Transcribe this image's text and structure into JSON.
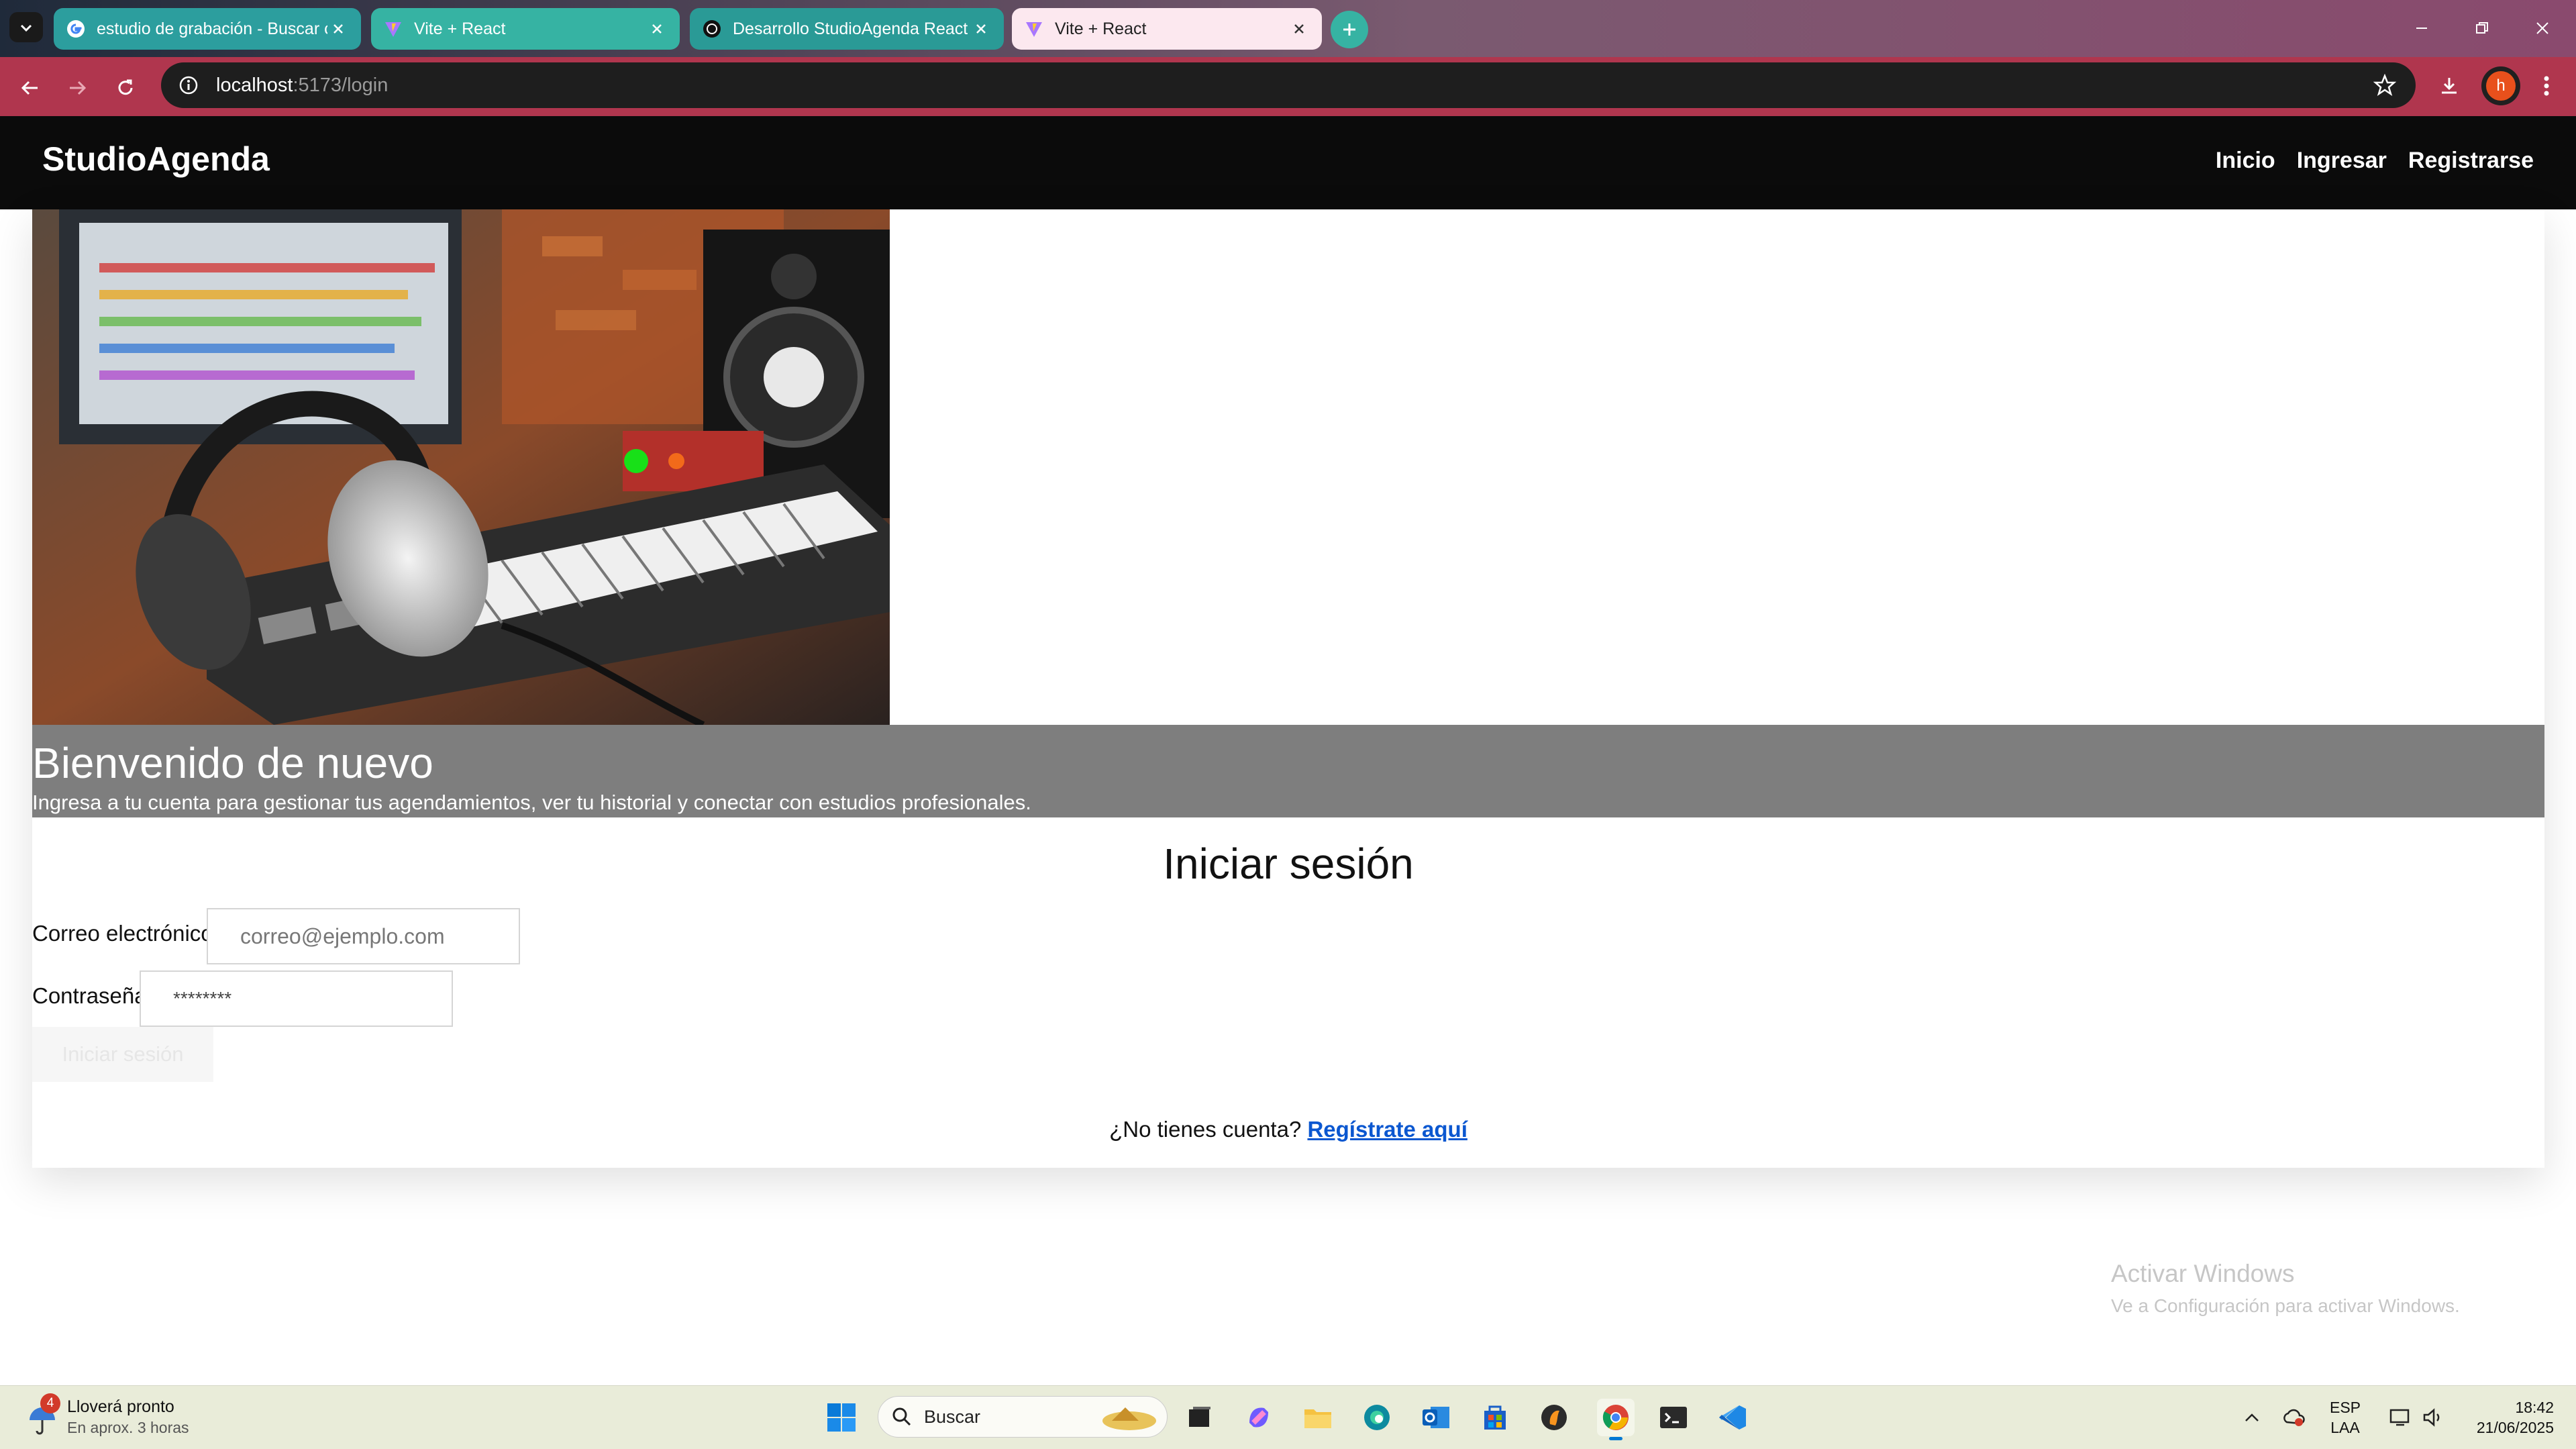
{
  "browser": {
    "tabs": [
      {
        "title": "estudio de grabación - Buscar c",
        "favicon": "google-icon"
      },
      {
        "title": "Vite + React",
        "favicon": "vite-icon"
      },
      {
        "title": "Desarrollo StudioAgenda React",
        "favicon": "chatgpt-icon"
      },
      {
        "title": "Vite + React",
        "favicon": "vite-icon",
        "active": true
      }
    ],
    "url_host": "localhost",
    "url_path": ":5173/login",
    "profile_initial": "h"
  },
  "app": {
    "brand": "StudioAgenda",
    "nav": [
      "Inicio",
      "Ingresar",
      "Registrarse"
    ]
  },
  "hero": {
    "title": "Bienvenido de nuevo",
    "subtitle": "Ingresa a tu cuenta para gestionar tus agendamientos, ver tu historial y conectar con estudios profesionales."
  },
  "login": {
    "heading": "Iniciar sesión",
    "email_label": "Correo electrónico",
    "email_placeholder": "correo@ejemplo.com",
    "password_label": "Contraseña",
    "password_value": "********",
    "submit_label": "Iniciar sesión",
    "no_account_text": "¿No tienes cuenta?",
    "register_link": "Regístrate aquí"
  },
  "watermark": {
    "title": "Activar Windows",
    "subtitle": "Ve a Configuración para activar Windows."
  },
  "taskbar": {
    "weather_badge": "4",
    "weather_title": "Lloverá pronto",
    "weather_sub": "En aprox. 3 horas",
    "search_placeholder": "Buscar",
    "lang_line1": "ESP",
    "lang_line2": "LAA",
    "time": "18:42",
    "date": "21/06/2025"
  },
  "colors": {
    "accent_teal": "#36b3a3",
    "address_bar": "#b0364e",
    "banner_gray": "#7e7e7e",
    "link_blue": "#0b57d0"
  }
}
